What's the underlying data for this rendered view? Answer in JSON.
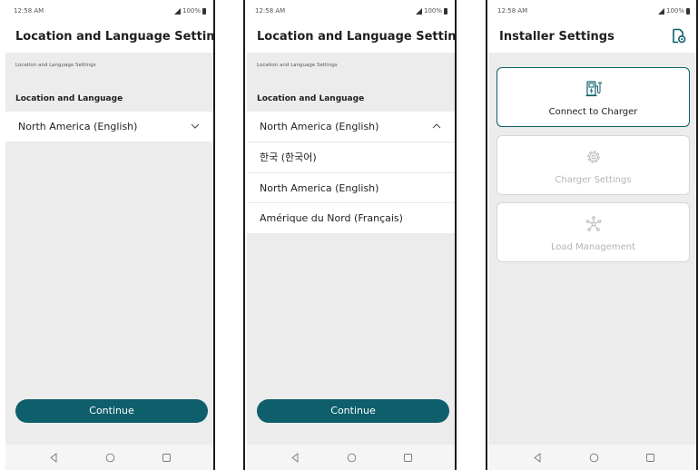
{
  "status_bar": {
    "time": "12:58 AM",
    "battery": "100%"
  },
  "screen1": {
    "title": "Location and Language Settings",
    "breadcrumb": "Location and Language Settings",
    "section_label": "Location and Language",
    "selected_value": "North America (English)",
    "continue_label": "Continue"
  },
  "screen2": {
    "title": "Location and Language Settings",
    "breadcrumb": "Location and Language Settings",
    "section_label": "Location and Language",
    "selected_value": "North America (English)",
    "options": [
      "한국 (한국어)",
      "North America (English)",
      "Amérique du Nord (Français)"
    ],
    "continue_label": "Continue"
  },
  "screen3": {
    "title": "Installer Settings",
    "cards": [
      {
        "label": "Connect to Charger",
        "state": "active",
        "icon": "charger-icon"
      },
      {
        "label": "Charger Settings",
        "state": "disabled",
        "icon": "gear-icon"
      },
      {
        "label": "Load Management",
        "state": "disabled",
        "icon": "network-icon"
      }
    ]
  },
  "colors": {
    "accent": "#0e5f6b",
    "background": "#ececec",
    "surface": "#ffffff",
    "disabled_text": "#b5b5b5"
  }
}
